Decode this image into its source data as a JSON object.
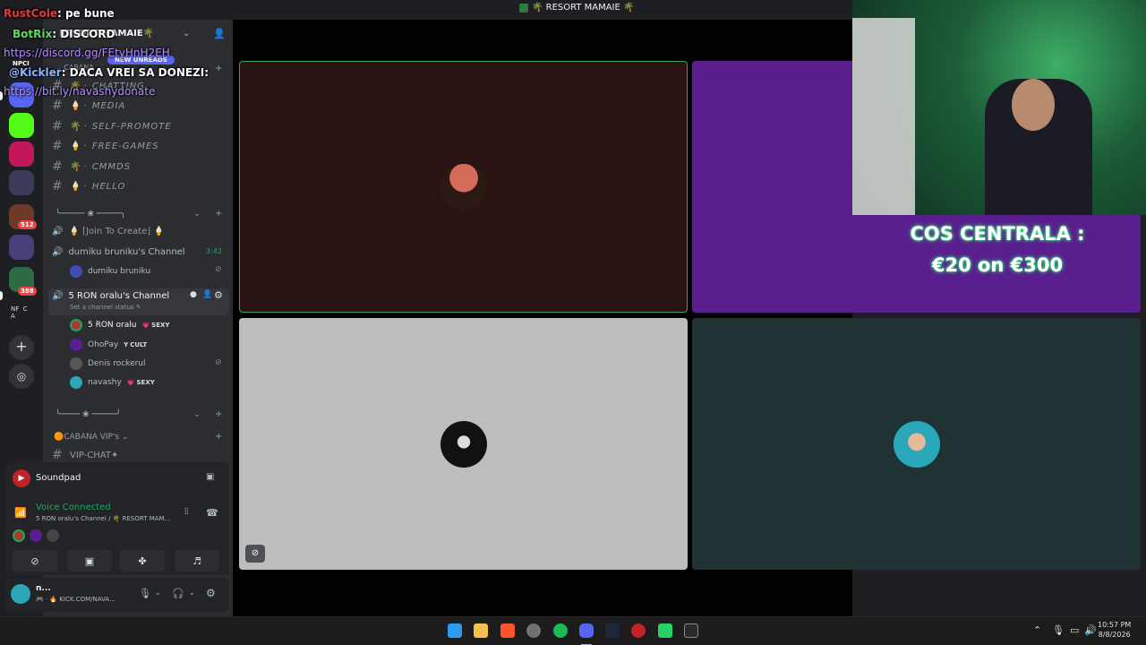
{
  "window": {
    "title": "🌴 RESORT MAMAIE 🌴"
  },
  "server": {
    "name": "RESORT MAMAIE🌴",
    "new_unreads": "NEW UNREADS",
    "category_top": "CABANA"
  },
  "rail": {
    "badge_512": "512",
    "badge_388": "388",
    "npci": "NPCI",
    "nf": "NF",
    "c": "C",
    "a": "A"
  },
  "channels": [
    {
      "prefix": "🌴 ·",
      "name": "CHATTING"
    },
    {
      "prefix": "🍦 ·",
      "name": "MEDIA"
    },
    {
      "prefix": "🌴 ·",
      "name": "SELF-PROMOTE"
    },
    {
      "prefix": "🍦 ·",
      "name": "FREE-GAMES"
    },
    {
      "prefix": "🌴 ·",
      "name": "CMMDS"
    },
    {
      "prefix": "🍦 ·",
      "name": "HELLO"
    }
  ],
  "voice": {
    "join_to_create": "🍦 ⌈Join To Create⌋ 🍦",
    "dumiku_channel": "dumiku bruniku's Channel",
    "dumiku_time": "3:42",
    "dumiku_user": "dumiku bruniku",
    "ron_channel": "5 RON oralu's Channel",
    "ron_status": "Set a channel status",
    "members": [
      {
        "name": "5 RON oralu",
        "tag": "SEXY",
        "tag_icon": "💗"
      },
      {
        "name": "OhoPay",
        "tag": "CULT",
        "tag_icon": "Y"
      },
      {
        "name": "Denis rockerul",
        "tag": "",
        "tag_icon": ""
      },
      {
        "name": "navashy",
        "tag": "SEXY",
        "tag_icon": "💗"
      }
    ],
    "cabana_vip": "CABANA VIP's",
    "vip_chat": "VIP-CHAT✦"
  },
  "soundpad": {
    "label": "Soundpad"
  },
  "voice_panel": {
    "status": "Voice Connected",
    "location": "5 RON oralu's Channel / 🌴 RESORT MAM..."
  },
  "user_panel": {
    "name": "n...",
    "status": "KICK.COM/NAVA..."
  },
  "overlay": {
    "chat": [
      {
        "user": "RustCole",
        "text": ": pe bune"
      },
      {
        "user": "BotRix",
        "text": ": DISCORD"
      },
      {
        "user": "",
        "text": "https://discord.gg/FEtyHnH2EH"
      },
      {
        "user": "@Kickler",
        "text": ": DACA VREI SA DONEZI:"
      },
      {
        "user": "",
        "text": "https://bit.ly/navashydonate"
      }
    ],
    "cos_line1": "COS CENTRALA :",
    "cos_line2": "€20 on €300"
  },
  "clock": {
    "time": "10:57 PM",
    "date": "8/8/2026"
  },
  "colors": {
    "accent_green": "#23a559",
    "purple_tile": "#5a1f8e",
    "discord_bg": "#2b2d31"
  }
}
